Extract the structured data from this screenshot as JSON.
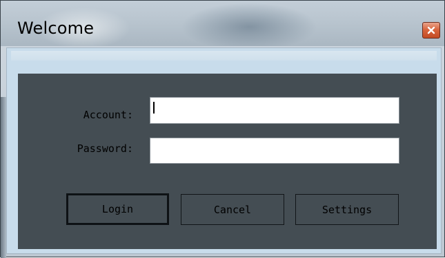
{
  "window": {
    "title": "Welcome",
    "close_icon": "close-icon"
  },
  "form": {
    "account_label": "Account:",
    "account_value": "",
    "password_label": "Password:",
    "password_value": ""
  },
  "buttons": {
    "login": "Login",
    "cancel": "Cancel",
    "settings": "Settings"
  },
  "colors": {
    "client_background": "#444d53",
    "close_button": "#d9663f"
  }
}
